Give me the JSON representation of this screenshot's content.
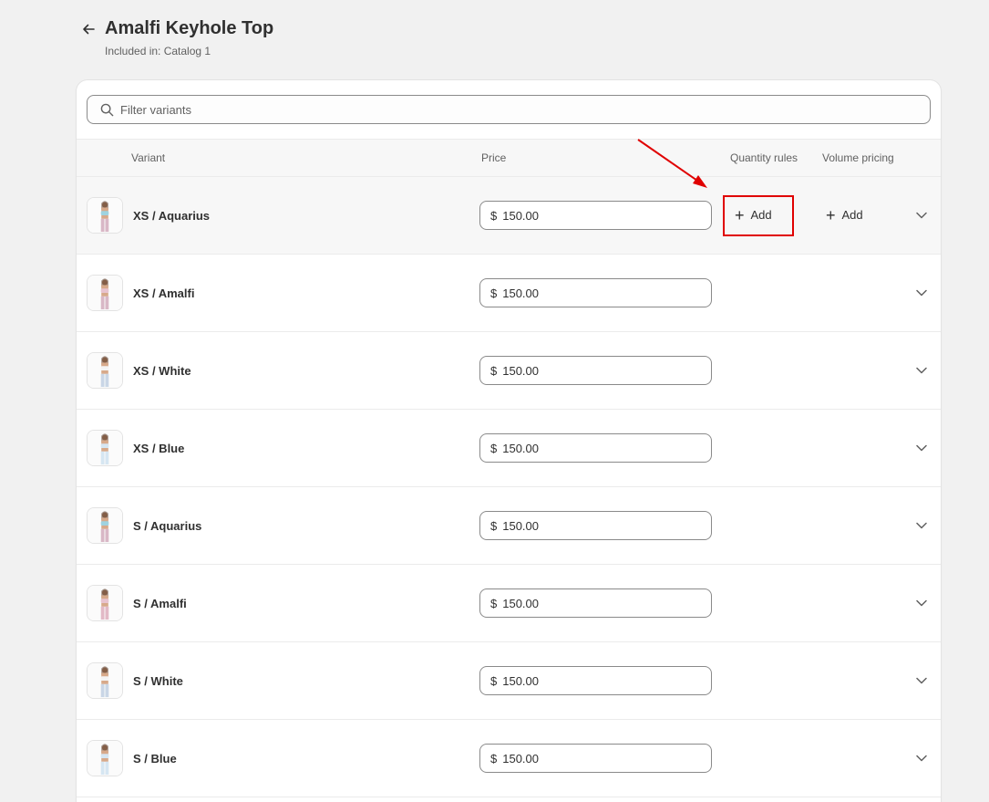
{
  "header": {
    "title": "Amalfi Keyhole Top",
    "subtitle": "Included in: Catalog 1"
  },
  "search": {
    "placeholder": "Filter variants",
    "value": ""
  },
  "table": {
    "columns": {
      "variant": "Variant",
      "price": "Price",
      "quantity_rules": "Quantity rules",
      "volume_pricing": "Volume pricing"
    },
    "add_label": "Add",
    "rows": [
      {
        "name": "XS / Aquarius",
        "currency": "$",
        "price": "150.00",
        "top_color": "#9fd3e0",
        "bottom_color": "#d9b7c6"
      },
      {
        "name": "XS / Amalfi",
        "currency": "$",
        "price": "150.00",
        "top_color": "#e8c3cf",
        "bottom_color": "#d9b7c6"
      },
      {
        "name": "XS / White",
        "currency": "$",
        "price": "150.00",
        "top_color": "#f4f4f4",
        "bottom_color": "#c9d6e6"
      },
      {
        "name": "XS / Blue",
        "currency": "$",
        "price": "150.00",
        "top_color": "#d6e6f2",
        "bottom_color": "#d6e6f2"
      },
      {
        "name": "S / Aquarius",
        "currency": "$",
        "price": "150.00",
        "top_color": "#9fd3e0",
        "bottom_color": "#d9b7c6"
      },
      {
        "name": "S / Amalfi",
        "currency": "$",
        "price": "150.00",
        "top_color": "#e8c3cf",
        "bottom_color": "#e2b9c6"
      },
      {
        "name": "S / White",
        "currency": "$",
        "price": "150.00",
        "top_color": "#f4f4f4",
        "bottom_color": "#c9d6e6"
      },
      {
        "name": "S / Blue",
        "currency": "$",
        "price": "150.00",
        "top_color": "#d6e6f2",
        "bottom_color": "#d6e6f2"
      }
    ]
  },
  "annotation": {
    "color": "#e00000"
  }
}
